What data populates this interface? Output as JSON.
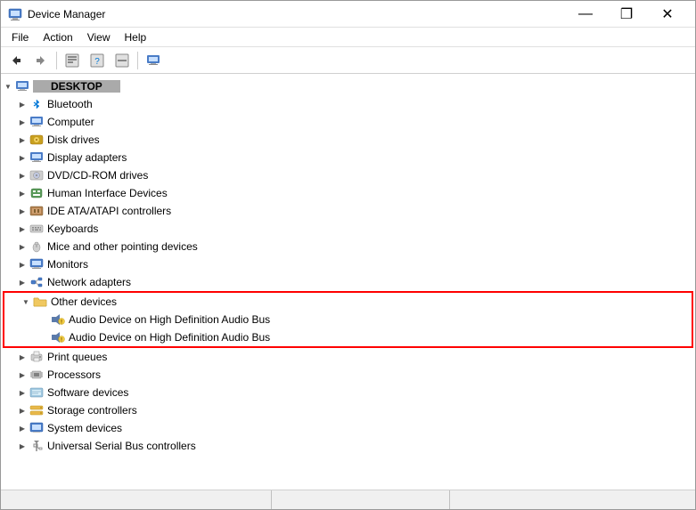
{
  "window": {
    "title": "Device Manager",
    "min_btn": "—",
    "max_btn": "❐",
    "close_btn": "✕"
  },
  "menu": {
    "items": [
      "File",
      "Action",
      "View",
      "Help"
    ]
  },
  "toolbar": {
    "buttons": [
      "←",
      "→",
      "⊞",
      "?",
      "⊟",
      "🖥"
    ]
  },
  "tree": {
    "root_label": "DESKTOP-XXXX",
    "items": [
      {
        "id": "bluetooth",
        "label": "Bluetooth",
        "indent": 1,
        "icon": "bluetooth",
        "toggle": "▶",
        "expanded": false
      },
      {
        "id": "computer",
        "label": "Computer",
        "indent": 1,
        "icon": "computer",
        "toggle": "▶",
        "expanded": false
      },
      {
        "id": "disk",
        "label": "Disk drives",
        "indent": 1,
        "icon": "disk",
        "toggle": "▶",
        "expanded": false
      },
      {
        "id": "display",
        "label": "Display adapters",
        "indent": 1,
        "icon": "monitor",
        "toggle": "▶",
        "expanded": false
      },
      {
        "id": "dvd",
        "label": "DVD/CD-ROM drives",
        "indent": 1,
        "icon": "dvd",
        "toggle": "▶",
        "expanded": false
      },
      {
        "id": "hid",
        "label": "Human Interface Devices",
        "indent": 1,
        "icon": "hid",
        "toggle": "▶",
        "expanded": false
      },
      {
        "id": "ide",
        "label": "IDE ATA/ATAPI controllers",
        "indent": 1,
        "icon": "ide",
        "toggle": "▶",
        "expanded": false
      },
      {
        "id": "keyboards",
        "label": "Keyboards",
        "indent": 1,
        "icon": "keyboard",
        "toggle": "▶",
        "expanded": false
      },
      {
        "id": "mice",
        "label": "Mice and other pointing devices",
        "indent": 1,
        "icon": "mouse",
        "toggle": "▶",
        "expanded": false
      },
      {
        "id": "monitors",
        "label": "Monitors",
        "indent": 1,
        "icon": "monitor",
        "toggle": "▶",
        "expanded": false
      },
      {
        "id": "network",
        "label": "Network adapters",
        "indent": 1,
        "icon": "network",
        "toggle": "▶",
        "expanded": false
      },
      {
        "id": "other",
        "label": "Other devices",
        "indent": 1,
        "icon": "folder",
        "toggle": "▼",
        "expanded": true
      },
      {
        "id": "audio1",
        "label": "Audio Device on High Definition Audio Bus",
        "indent": 2,
        "icon": "warning",
        "toggle": "",
        "expanded": false,
        "highlight": true
      },
      {
        "id": "audio2",
        "label": "Audio Device on High Definition Audio Bus",
        "indent": 2,
        "icon": "warning",
        "toggle": "",
        "expanded": false,
        "highlight": true
      },
      {
        "id": "print",
        "label": "Print queues",
        "indent": 1,
        "icon": "print",
        "toggle": "▶",
        "expanded": false
      },
      {
        "id": "processors",
        "label": "Processors",
        "indent": 1,
        "icon": "cpu",
        "toggle": "▶",
        "expanded": false
      },
      {
        "id": "software",
        "label": "Software devices",
        "indent": 1,
        "icon": "software",
        "toggle": "▶",
        "expanded": false
      },
      {
        "id": "storage",
        "label": "Storage controllers",
        "indent": 1,
        "icon": "storage",
        "toggle": "▶",
        "expanded": false
      },
      {
        "id": "system",
        "label": "System devices",
        "indent": 1,
        "icon": "system",
        "toggle": "▶",
        "expanded": false
      },
      {
        "id": "usb",
        "label": "Universal Serial Bus controllers",
        "indent": 1,
        "icon": "usb",
        "toggle": "▶",
        "expanded": false
      }
    ]
  },
  "status": {
    "text": ""
  }
}
